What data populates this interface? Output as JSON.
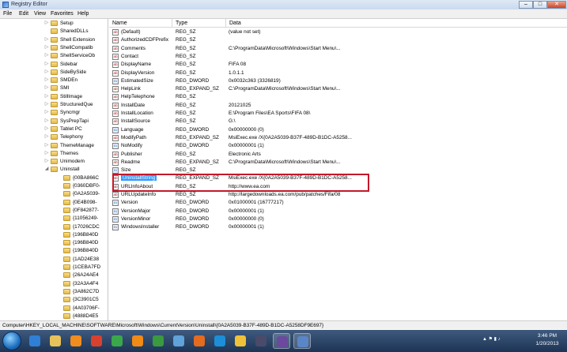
{
  "window": {
    "title": "Registry Editor",
    "controls": {
      "minimize": "–",
      "maximize": "□",
      "close": "✕"
    }
  },
  "menu": [
    "File",
    "Edit",
    "View",
    "Favorites",
    "Help"
  ],
  "tree": {
    "items": [
      {
        "label": "Setup",
        "level": 0,
        "exp": "▷"
      },
      {
        "label": "SharedDLLs",
        "level": 0,
        "exp": ""
      },
      {
        "label": "Shell Extension",
        "level": 0,
        "exp": "▷"
      },
      {
        "label": "ShellCompatib",
        "level": 0,
        "exp": "▷"
      },
      {
        "label": "ShellServiceOb",
        "level": 0,
        "exp": "▷"
      },
      {
        "label": "Sidebar",
        "level": 0,
        "exp": "▷"
      },
      {
        "label": "SideBySide",
        "level": 0,
        "exp": "▷"
      },
      {
        "label": "SMDEn",
        "level": 0,
        "exp": "▷"
      },
      {
        "label": "SMI",
        "level": 0,
        "exp": "▷"
      },
      {
        "label": "StillImage",
        "level": 0,
        "exp": "▷"
      },
      {
        "label": "StructuredQue",
        "level": 0,
        "exp": "▷"
      },
      {
        "label": "Syncmgr",
        "level": 0,
        "exp": "▷"
      },
      {
        "label": "SysPrepTapi",
        "level": 0,
        "exp": "▷"
      },
      {
        "label": "Tablet PC",
        "level": 0,
        "exp": "▷"
      },
      {
        "label": "Telephony",
        "level": 0,
        "exp": "▷"
      },
      {
        "label": "ThemeManage",
        "level": 0,
        "exp": "▷"
      },
      {
        "label": "Themes",
        "level": 0,
        "exp": "▷"
      },
      {
        "label": "Unimodem",
        "level": 0,
        "exp": "▷"
      },
      {
        "label": "Uninstall",
        "level": 0,
        "exp": "◢"
      },
      {
        "label": "{00BA866C",
        "level": 1,
        "exp": ""
      },
      {
        "label": "{0360DBF0-",
        "level": 1,
        "exp": ""
      },
      {
        "label": "{0A2A5039-",
        "level": 1,
        "exp": ""
      },
      {
        "label": "{0E4B098-",
        "level": 1,
        "exp": ""
      },
      {
        "label": "{0F842877-",
        "level": 1,
        "exp": ""
      },
      {
        "label": "{11056249-",
        "level": 1,
        "exp": ""
      },
      {
        "label": "{17026CDC",
        "level": 1,
        "exp": ""
      },
      {
        "label": "{196B840D",
        "level": 1,
        "exp": ""
      },
      {
        "label": "{196B840D",
        "level": 1,
        "exp": ""
      },
      {
        "label": "{196B840D",
        "level": 1,
        "exp": ""
      },
      {
        "label": "{1AD24E38",
        "level": 1,
        "exp": ""
      },
      {
        "label": "{1CEBA7FD",
        "level": 1,
        "exp": ""
      },
      {
        "label": "{26A24AE4",
        "level": 1,
        "exp": ""
      },
      {
        "label": "{32A3A4F4",
        "level": 1,
        "exp": ""
      },
      {
        "label": "{3A862C7D",
        "level": 1,
        "exp": ""
      },
      {
        "label": "{3C3901C5",
        "level": 1,
        "exp": ""
      },
      {
        "label": "{4A03706F-",
        "level": 1,
        "exp": ""
      },
      {
        "label": "{4888D4E5",
        "level": 1,
        "exp": ""
      }
    ]
  },
  "list": {
    "headers": {
      "name": "Name",
      "type": "Type",
      "data": "Data"
    },
    "rows": [
      {
        "icon": "ab",
        "name": "(Default)",
        "type": "REG_SZ",
        "data": "(value not set)"
      },
      {
        "icon": "ab",
        "name": "AuthorizedCDFPrefix",
        "type": "REG_SZ",
        "data": ""
      },
      {
        "icon": "ab",
        "name": "Comments",
        "type": "REG_SZ",
        "data": "C:\\ProgramData\\Microsoft\\Windows\\Start Menu\\..."
      },
      {
        "icon": "ab",
        "name": "Contact",
        "type": "REG_SZ",
        "data": ""
      },
      {
        "icon": "ab",
        "name": "DisplayName",
        "type": "REG_SZ",
        "data": "FIFA 08"
      },
      {
        "icon": "ab",
        "name": "DisplayVersion",
        "type": "REG_SZ",
        "data": "1.0.1.1"
      },
      {
        "icon": "01",
        "name": "EstimatedSize",
        "type": "REG_DWORD",
        "data": "0x0032c363 (3326819)"
      },
      {
        "icon": "ab",
        "name": "HelpLink",
        "type": "REG_EXPAND_SZ",
        "data": "C:\\ProgramData\\Microsoft\\Windows\\Start Menu\\..."
      },
      {
        "icon": "ab",
        "name": "HelpTelephone",
        "type": "REG_SZ",
        "data": ""
      },
      {
        "icon": "ab",
        "name": "InstallDate",
        "type": "REG_SZ",
        "data": "20121025"
      },
      {
        "icon": "ab",
        "name": "InstallLocation",
        "type": "REG_SZ",
        "data": "E:\\Program Files\\EA Sports\\FIFA 08\\"
      },
      {
        "icon": "ab",
        "name": "InstallSource",
        "type": "REG_SZ",
        "data": "G:\\"
      },
      {
        "icon": "01",
        "name": "Language",
        "type": "REG_DWORD",
        "data": "0x00000000 (0)"
      },
      {
        "icon": "ab",
        "name": "ModifyPath",
        "type": "REG_EXPAND_SZ",
        "data": "MsiExec.exe /X{0A2A5039-B37F-489D-B1DC-A5258..."
      },
      {
        "icon": "01",
        "name": "NoModify",
        "type": "REG_DWORD",
        "data": "0x00000001 (1)"
      },
      {
        "icon": "ab",
        "name": "Publisher",
        "type": "REG_SZ",
        "data": "Electronic Arts"
      },
      {
        "icon": "ab",
        "name": "Readme",
        "type": "REG_EXPAND_SZ",
        "data": "C:\\ProgramData\\Microsoft\\Windows\\Start Menu\\..."
      },
      {
        "icon": "01",
        "name": "Size",
        "type": "REG_SZ",
        "data": ""
      },
      {
        "icon": "ab",
        "name": "UninstallString",
        "type": "REG_EXPAND_SZ",
        "data": "MsiExec.exe /X{0A2A5039-B37F-489D-B1DC-A5258...",
        "selected": true
      },
      {
        "icon": "ab",
        "name": "URLInfoAbout",
        "type": "REG_SZ",
        "data": "http://www.ea.com"
      },
      {
        "icon": "ab",
        "name": "URLUpdateInfo",
        "type": "REG_SZ",
        "data": "http://largedownloads.ea.com/pub/patches/Fifa/08"
      },
      {
        "icon": "01",
        "name": "Version",
        "type": "REG_DWORD",
        "data": "0x01000001 (16777217)"
      },
      {
        "icon": "01",
        "name": "VersionMajor",
        "type": "REG_DWORD",
        "data": "0x00000001 (1)"
      },
      {
        "icon": "01",
        "name": "VersionMinor",
        "type": "REG_DWORD",
        "data": "0x00000000 (0)"
      },
      {
        "icon": "01",
        "name": "WindowsInstaller",
        "type": "REG_DWORD",
        "data": "0x00000001 (1)"
      }
    ]
  },
  "status": "Computer\\HKEY_LOCAL_MACHINE\\SOFTWARE\\Microsoft\\Windows\\CurrentVersion\\Uninstall\\{0A2A5039-B37F-489D-B1DC-A5258DF9E697}",
  "taskbar": {
    "apps": [
      {
        "name": "ie-icon",
        "color": "#2f7fd6",
        "active": false
      },
      {
        "name": "explorer-icon",
        "color": "#e7c25a",
        "active": false
      },
      {
        "name": "media-player-icon",
        "color": "#f18c1f",
        "active": false
      },
      {
        "name": "chrome-icon",
        "color": "#d9412f",
        "active": false
      },
      {
        "name": "green-app-icon",
        "color": "#3aa84a",
        "active": false
      },
      {
        "name": "vlc-icon",
        "color": "#f28a16",
        "active": false
      },
      {
        "name": "chrome-icon-2",
        "color": "#3b9a3f",
        "active": false
      },
      {
        "name": "paint-icon",
        "color": "#5fa3d8",
        "active": false
      },
      {
        "name": "firefox-icon",
        "color": "#e56b1f",
        "active": false
      },
      {
        "name": "skype-icon",
        "color": "#1c8fd8",
        "active": false
      },
      {
        "name": "talk-icon",
        "color": "#f0c23a",
        "active": false
      },
      {
        "name": "dark-app-icon",
        "color": "#4a4a6a",
        "active": false
      },
      {
        "name": "visual-studio-icon",
        "color": "#6b4a9e",
        "active": true
      },
      {
        "name": "regedit-icon",
        "color": "#5a86c8",
        "active": true
      }
    ],
    "clock_time": "3:46 PM",
    "clock_date": "1/20/2013"
  }
}
